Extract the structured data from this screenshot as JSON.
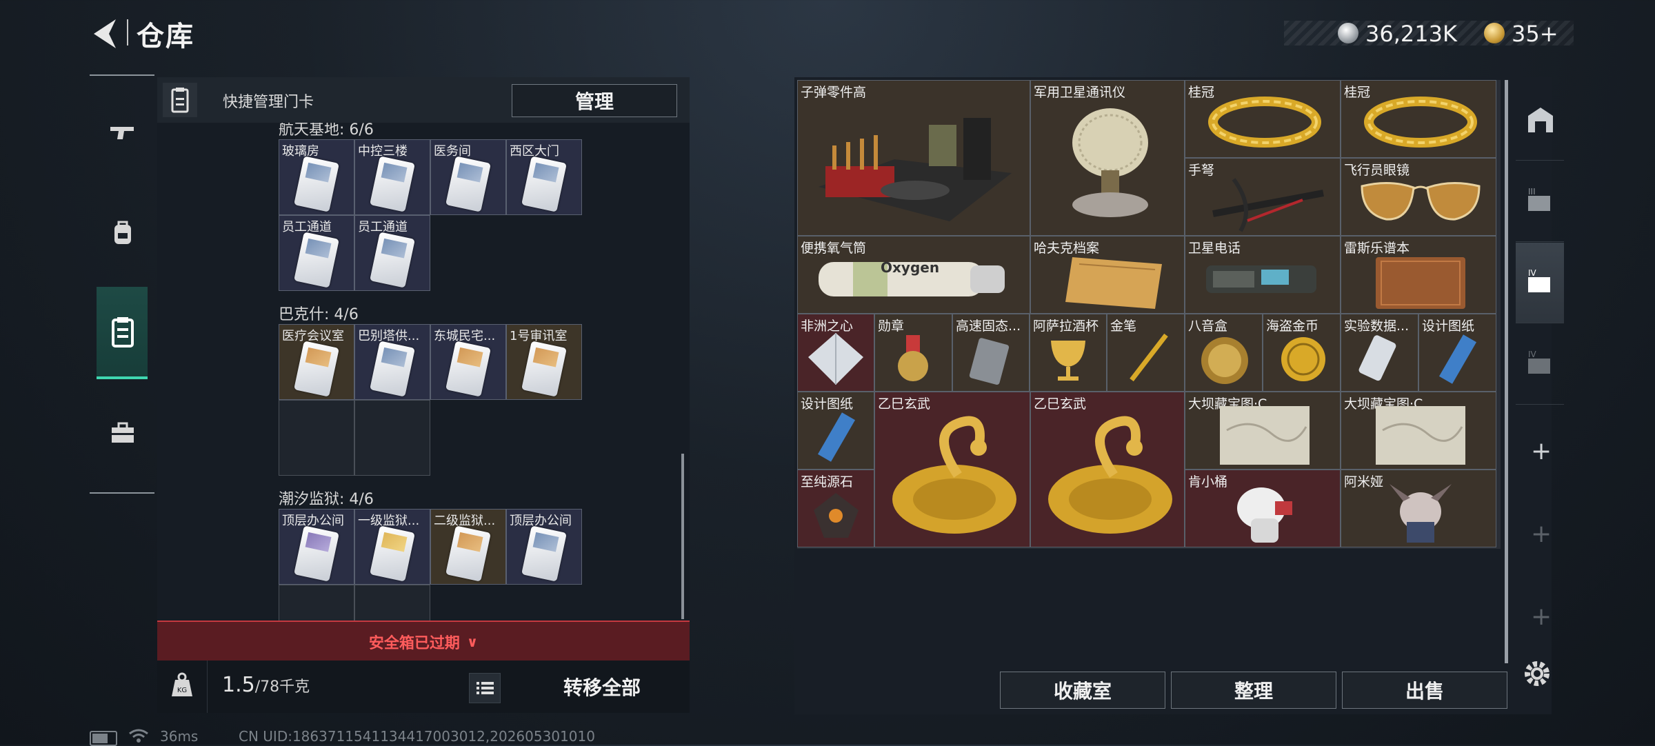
{
  "header": {
    "title": "仓库",
    "currency_1": "36,213K",
    "currency_2": "35+"
  },
  "left_panel": {
    "header_label": "快捷管理门卡",
    "manage_label": "管理",
    "groups": [
      {
        "title": "航天基地: 6/6",
        "slots": [
          "玻璃房",
          "中控三楼",
          "医务间",
          "西区大门",
          "员工通道",
          "员工通道"
        ]
      },
      {
        "title": "巴克什: 4/6",
        "slots": [
          "医疗会议室",
          "巴别塔供...",
          "东城民宅...",
          "1号审讯室"
        ]
      },
      {
        "title": "潮汐监狱: 4/6",
        "slots": [
          "顶层办公间",
          "一级监狱...",
          "二级监狱...",
          "顶层办公间"
        ]
      }
    ],
    "safe_box_status": "安全箱已过期",
    "weight_value": "1.5",
    "weight_max": "/78千克",
    "transfer_label": "转移全部"
  },
  "storage": {
    "items": [
      {
        "name": "子弹零件高"
      },
      {
        "name": "军用卫星通讯仪"
      },
      {
        "name": "桂冠"
      },
      {
        "name": "桂冠"
      },
      {
        "name": "手弩"
      },
      {
        "name": "飞行员眼镜"
      },
      {
        "name": "便携氧气筒"
      },
      {
        "name": "哈夫克档案"
      },
      {
        "name": "卫星电话"
      },
      {
        "name": "雷斯乐谱本"
      },
      {
        "name": "非洲之心"
      },
      {
        "name": "勋章"
      },
      {
        "name": "高速固态..."
      },
      {
        "name": "阿萨拉酒杯"
      },
      {
        "name": "金笔"
      },
      {
        "name": "八音盒"
      },
      {
        "name": "海盗金币"
      },
      {
        "name": "实验数据..."
      },
      {
        "name": "设计图纸"
      },
      {
        "name": "设计图纸"
      },
      {
        "name": "乙巳玄武"
      },
      {
        "name": "乙巳玄武"
      },
      {
        "name": "大坝藏宝图·C"
      },
      {
        "name": "大坝藏宝图·C"
      },
      {
        "name": "至纯源石"
      },
      {
        "name": "肯小桶"
      },
      {
        "name": "阿米娅"
      }
    ],
    "buttons": {
      "collection": "收藏室",
      "sort": "整理",
      "sell": "出售"
    }
  },
  "status_bar": {
    "ping": "36ms",
    "uid": "CN UID:1863711541134417003012,202605301010"
  }
}
